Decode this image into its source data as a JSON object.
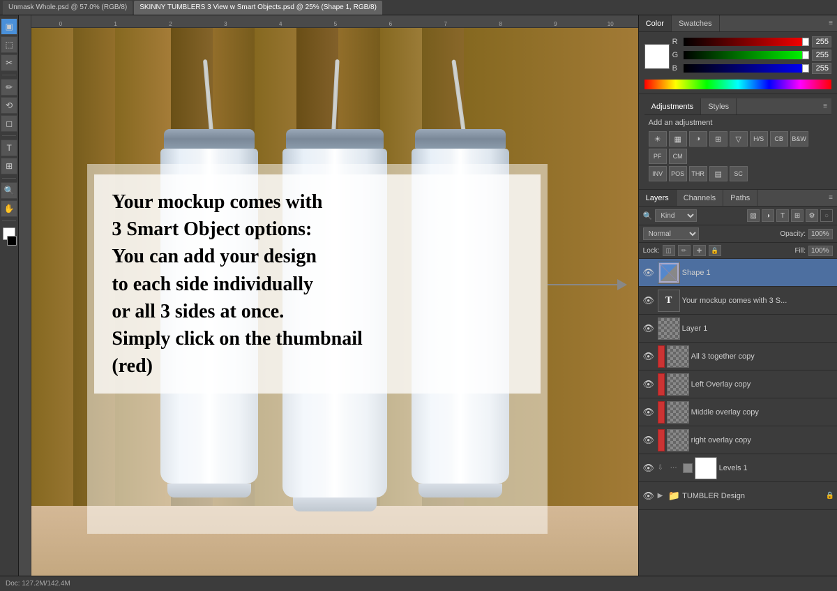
{
  "tabs": [
    {
      "label": "Unmask Whole.psd @ 57.0% (RGB/8)",
      "active": false
    },
    {
      "label": "SKINNY TUMBLERS 3 View w Smart Objects.psd @ 25% (Shape 1, RGB/8)",
      "active": true
    }
  ],
  "color_panel": {
    "tab_color": "Color",
    "tab_swatches": "Swatches",
    "r_label": "R",
    "g_label": "G",
    "b_label": "B",
    "r_value": "255",
    "g_value": "255",
    "b_value": "255"
  },
  "adjustments_panel": {
    "tab_adjustments": "Adjustments",
    "tab_styles": "Styles",
    "add_label": "Add an adjustment",
    "icons": [
      "☀",
      "⊞",
      "◑",
      "▦",
      "▽",
      "💧",
      "〰",
      "◐",
      "◑",
      "▤",
      "⋯",
      "⊡",
      "⊠",
      "✖"
    ]
  },
  "layers_panel": {
    "tab_layers": "Layers",
    "tab_channels": "Channels",
    "tab_paths": "Paths",
    "filter_kind": "Kind",
    "blend_mode": "Normal",
    "opacity_label": "Opacity:",
    "opacity_value": "100%",
    "lock_label": "Lock:",
    "fill_label": "Fill:",
    "fill_value": "100%",
    "layers": [
      {
        "name": "Shape 1",
        "type": "shape",
        "visible": true,
        "selected": true,
        "red_marker": false
      },
      {
        "name": "Your mockup comes with 3 S...",
        "type": "text",
        "visible": true,
        "selected": false,
        "red_marker": false
      },
      {
        "name": "Layer 1",
        "type": "checker",
        "visible": true,
        "selected": false,
        "red_marker": false
      },
      {
        "name": "All 3 together copy",
        "type": "checker",
        "visible": true,
        "selected": false,
        "red_marker": true
      },
      {
        "name": "Left Overlay copy",
        "type": "checker",
        "visible": true,
        "selected": false,
        "red_marker": true
      },
      {
        "name": "Middle overlay copy",
        "type": "checker",
        "visible": true,
        "selected": false,
        "red_marker": true
      },
      {
        "name": "right overlay copy",
        "type": "checker",
        "visible": true,
        "selected": false,
        "red_marker": true
      },
      {
        "name": "Levels 1",
        "type": "levels",
        "visible": true,
        "selected": false,
        "red_marker": false
      },
      {
        "name": "TUMBLER Design",
        "type": "folder",
        "visible": true,
        "selected": false,
        "red_marker": false,
        "locked": true
      }
    ]
  },
  "canvas": {
    "text_overlay": "Your mockup comes with\n3 Smart Object options:\nYou can add your design\nto each side individually\nor all 3 sides at once.\nSimply click on the thumbnail\n(red)"
  },
  "tools": [
    "▣",
    "✂",
    "⬚",
    "⋯",
    "✏",
    "⟲",
    "T",
    "⊞",
    "📐",
    "⟵",
    "🔍",
    "▨"
  ]
}
